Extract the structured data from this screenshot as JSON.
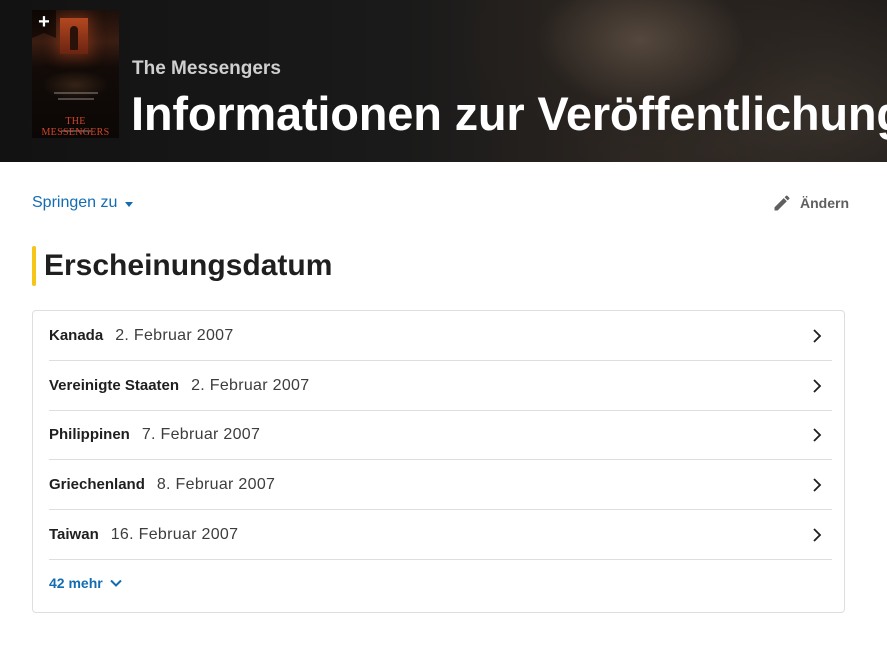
{
  "header": {
    "movie_title": "The Messengers",
    "page_title": "Informationen zur Veröffentlichung",
    "poster": {
      "title_text": "THE MESSENGERS",
      "add_icon": "plus-icon",
      "add_symbol": "+"
    }
  },
  "toolbar": {
    "jump_label": "Springen zu",
    "jump_icon": "caret-down-icon",
    "edit_label": "Ändern",
    "edit_icon": "pencil-icon"
  },
  "section": {
    "title": "Erscheinungsdatum",
    "accent_color": "#f5c518"
  },
  "release_dates": [
    {
      "country": "Kanada",
      "date": "2. Februar 2007"
    },
    {
      "country": "Vereinigte Staaten",
      "date": "2. Februar 2007"
    },
    {
      "country": "Philippinen",
      "date": "7. Februar 2007"
    },
    {
      "country": "Griechenland",
      "date": "8. Februar 2007"
    },
    {
      "country": "Taiwan",
      "date": "16. Februar 2007"
    }
  ],
  "more": {
    "label": "42 mehr",
    "icon": "chevron-down-icon"
  },
  "colors": {
    "link": "#136cb2",
    "accent": "#f5c518"
  }
}
